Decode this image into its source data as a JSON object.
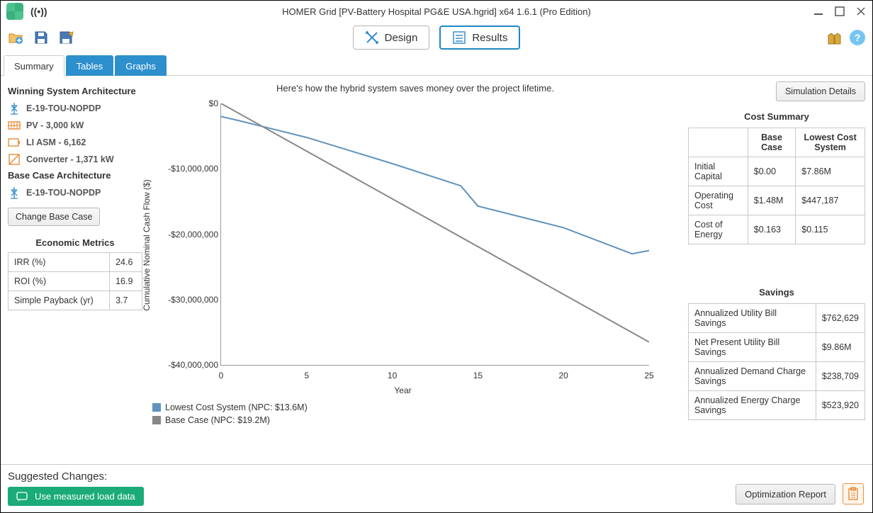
{
  "window": {
    "title": "HOMER Grid  [PV-Battery Hospital PG&E USA.hgrid]   x64 1.6.1 (Pro Edition)"
  },
  "toolbar": {
    "design_label": "Design",
    "results_label": "Results"
  },
  "tabs": {
    "summary": "Summary",
    "tables": "Tables",
    "graphs": "Graphs"
  },
  "left": {
    "winning_heading": "Winning System Architecture",
    "winning_items": [
      "E-19-TOU-NOPDP",
      "PV - 3,000 kW",
      "LI ASM - 6,162",
      "Converter - 1,371 kW"
    ],
    "base_heading": "Base Case Architecture",
    "base_items": [
      "E-19-TOU-NOPDP"
    ],
    "change_base": "Change Base Case",
    "econ_heading": "Economic Metrics",
    "econ_rows": [
      {
        "label": "IRR (%)",
        "value": "24.6"
      },
      {
        "label": "ROI (%)",
        "value": "16.9"
      },
      {
        "label": "Simple Payback (yr)",
        "value": "3.7"
      }
    ]
  },
  "chart": {
    "caption": "Here's how the hybrid system saves money over the project lifetime.",
    "sim_details": "Simulation Details",
    "yaxis_label": "Cumulative Nominal Cash Flow ($)",
    "xaxis_label": "Year",
    "legend1": "Lowest Cost System (NPC: $13.6M)",
    "legend2": "Base Case (NPC: $19.2M)"
  },
  "chart_data": {
    "type": "line",
    "title": "Cumulative Nominal Cash Flow",
    "xlabel": "Year",
    "ylabel": "Cumulative Nominal Cash Flow ($)",
    "xlim": [
      0,
      25
    ],
    "ylim": [
      -40000000,
      0
    ],
    "yticks": [
      "$0",
      "-$10,000,000",
      "-$20,000,000",
      "-$30,000,000",
      "-$40,000,000"
    ],
    "xticks": [
      "0",
      "5",
      "10",
      "15",
      "20",
      "25"
    ],
    "series": [
      {
        "name": "Lowest Cost System (NPC: $13.6M)",
        "color": "#5f93bd",
        "x": [
          0,
          1,
          5,
          10,
          14,
          15,
          20,
          24,
          25
        ],
        "values": [
          -2000000,
          -2600000,
          -5200000,
          -9200000,
          -12600000,
          -15700000,
          -19000000,
          -23000000,
          -22500000
        ]
      },
      {
        "name": "Base Case (NPC: $19.2M)",
        "color": "#878787",
        "x": [
          0,
          5,
          10,
          15,
          20,
          25
        ],
        "values": [
          0,
          -7300000,
          -14600000,
          -21900000,
          -29200000,
          -36500000
        ]
      }
    ]
  },
  "right": {
    "cost_heading": "Cost Summary",
    "cost_cols": [
      "",
      "Base Case",
      "Lowest Cost System"
    ],
    "cost_rows": [
      {
        "label": "Initial Capital",
        "base": "$0.00",
        "low": "$7.86M"
      },
      {
        "label": "Operating Cost",
        "base": "$1.48M",
        "low": "$447,187"
      },
      {
        "label": "Cost of Energy",
        "base": "$0.163",
        "low": "$0.115"
      }
    ],
    "savings_heading": "Savings",
    "savings_rows": [
      {
        "label": "Annualized Utility Bill Savings",
        "value": "$762,629"
      },
      {
        "label": "Net Present Utility Bill Savings",
        "value": "$9.86M"
      },
      {
        "label": "Annualized Demand Charge Savings",
        "value": "$238,709"
      },
      {
        "label": "Annualized Energy Charge Savings",
        "value": "$523,920"
      }
    ]
  },
  "footer": {
    "title": "Suggested Changes:",
    "chip": "Use measured load data",
    "report": "Optimization Report"
  }
}
